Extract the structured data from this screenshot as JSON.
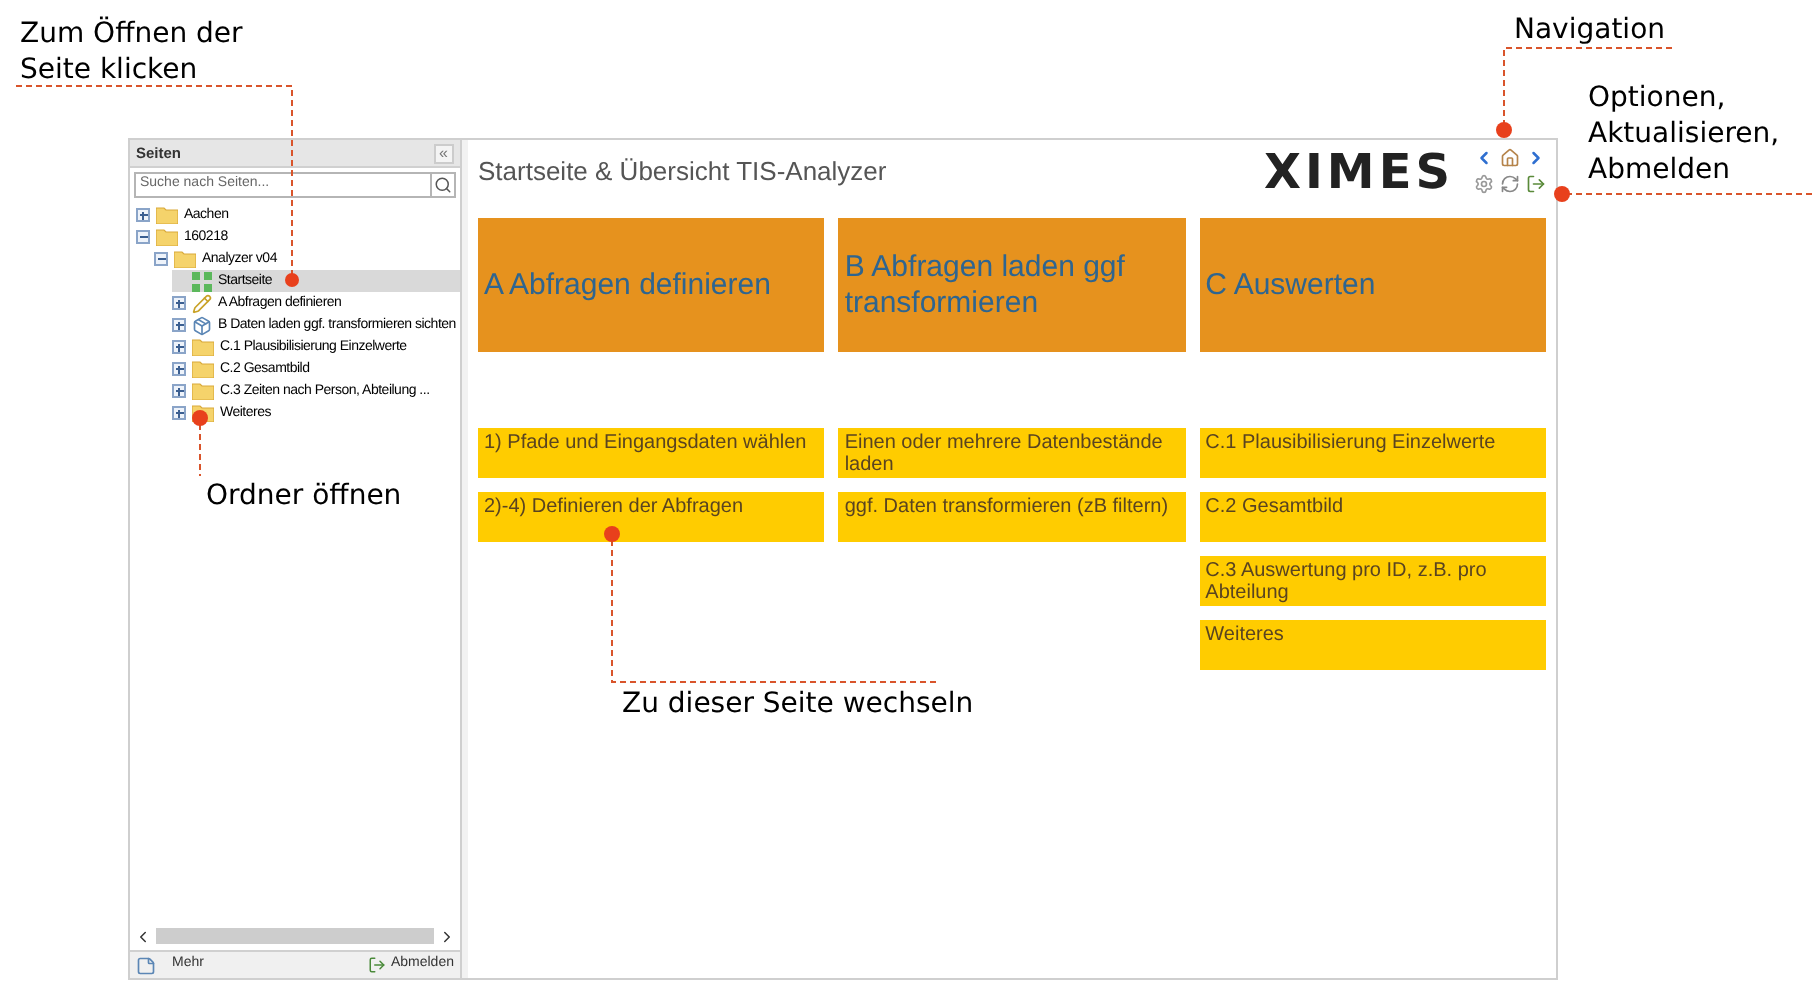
{
  "annotations": [
    {
      "text": "Zum Öffnen der Seite klicken"
    },
    {
      "text": "Ordner öffnen"
    },
    {
      "text": "Zu dieser Seite wechseln"
    },
    {
      "text": "Navigation"
    },
    {
      "text": "Optionen, Aktualisieren, Abmelden"
    }
  ],
  "sidebar": {
    "title": "Seiten",
    "collapse": "«",
    "search": {
      "placeholder": "Suche nach Seiten..."
    },
    "tree": [
      {
        "label": "Aachen",
        "kind": "folder",
        "expanded": false
      },
      {
        "label": "160218",
        "kind": "folder",
        "expanded": true,
        "children": [
          {
            "label": "Analyzer v04",
            "kind": "folder",
            "expanded": true,
            "children": [
              {
                "label": "Startseite",
                "kind": "start",
                "selected": true
              },
              {
                "label": "A Abfragen definieren",
                "kind": "edit",
                "expanded": false,
                "selected": false
              },
              {
                "label": "B Daten laden ggf. transformieren sichten",
                "kind": "load",
                "expanded": false,
                "selected": false
              },
              {
                "label": "C.1 Plausibilisierung Einzelwerte",
                "kind": "folder",
                "expanded": false,
                "selected": false
              },
              {
                "label": "C.2 Gesamtbild",
                "kind": "folder",
                "expanded": false,
                "selected": false
              },
              {
                "label": "C.3 Zeiten nach Person, Abteilung ...",
                "kind": "folder",
                "expanded": false,
                "selected": false
              },
              {
                "label": "Weiteres",
                "kind": "folder",
                "expanded": false,
                "selected": false
              }
            ]
          }
        ]
      }
    ],
    "footer": {
      "more": "Mehr",
      "logout": "Abmelden"
    }
  },
  "main": {
    "title": "Startseite & Übersicht TIS-Analyzer",
    "logo": "XIMES",
    "columns": [
      {
        "heading": "A Abfragen definieren",
        "links": [
          "1) Pfade und Eingangsdaten wählen",
          "2)-4) Definieren der Abfragen"
        ]
      },
      {
        "heading": "B Abfragen laden ggf transformieren",
        "links": [
          "Einen oder mehrere Datenbestände laden",
          "ggf. Daten transformieren (zB filtern)"
        ]
      },
      {
        "heading": "C Auswerten",
        "links": [
          "C.1 Plausibilisierung Einzelwerte",
          "C.2 Gesamtbild",
          "C.3 Auswertung pro ID, z.B. pro Abteilung",
          "Weiteres"
        ]
      }
    ]
  }
}
